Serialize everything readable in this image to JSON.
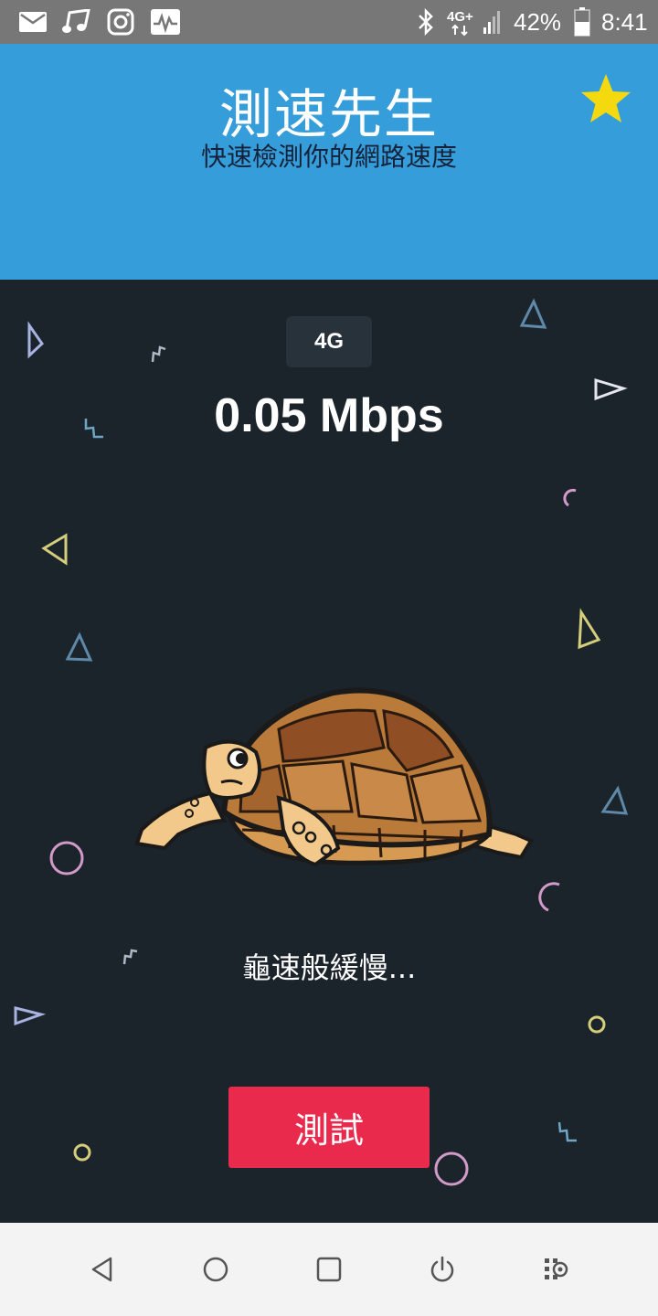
{
  "status_bar": {
    "icons": [
      "mail-icon",
      "music-icon",
      "instagram-icon",
      "activity-icon",
      "bluetooth-icon",
      "network-4g-plus-icon",
      "signal-icon",
      "battery-icon"
    ],
    "network_label": "4G+",
    "battery_percent": "42%",
    "time": "8:41"
  },
  "header": {
    "title": "測速先生",
    "subtitle": "快速檢測你的網路速度",
    "favorite_icon": "star-icon",
    "favorite_color": "#f5d90f"
  },
  "result": {
    "network_type": "4G",
    "speed": "0.05 Mbps",
    "message": "龜速般緩慢..."
  },
  "actions": {
    "test_label": "測試"
  },
  "nav_bar": {
    "buttons": [
      "back-icon",
      "home-icon",
      "recents-icon",
      "power-icon",
      "settings-icon"
    ]
  },
  "colors": {
    "header_bg": "#369ddb",
    "main_bg": "#1b232b",
    "button_bg": "#e92a4d",
    "status_bar_bg": "#777777",
    "nav_bar_bg": "#f3f3f3"
  }
}
